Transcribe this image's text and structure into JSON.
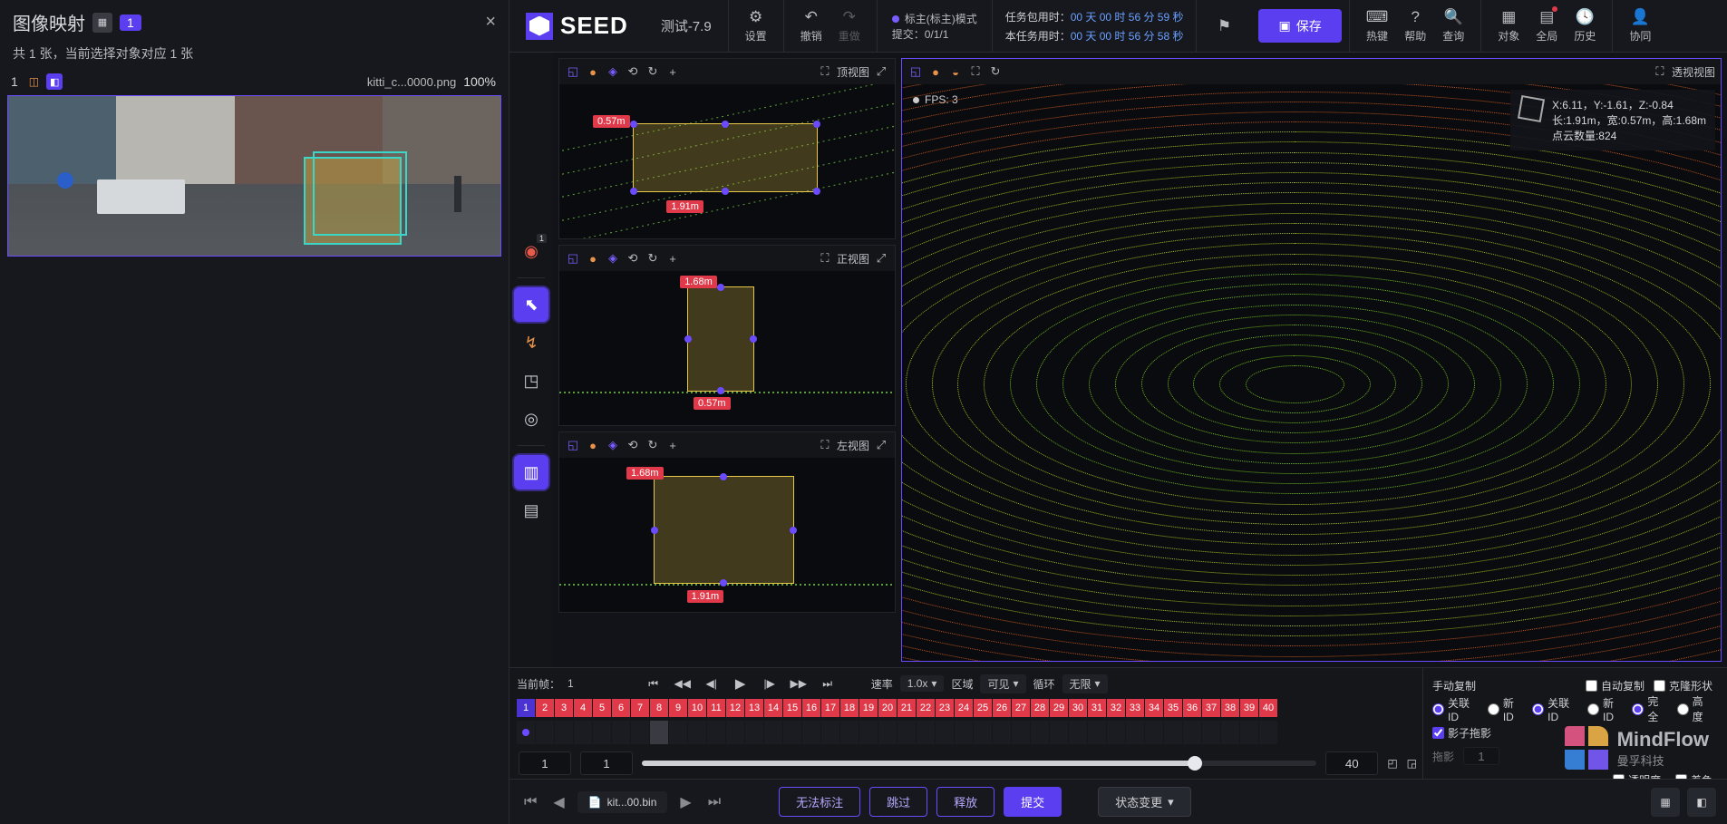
{
  "leftPanel": {
    "title": "图像映射",
    "badgeCount": "1",
    "subtitle": "共 1 张，当前选择对象对应 1 张",
    "thumb": {
      "index": "1",
      "file": "kitti_c...0000.png",
      "zoom": "100%"
    }
  },
  "header": {
    "logo": "SEED",
    "subtitle": "测试-7.9",
    "settings": "设置",
    "undo": "撤销",
    "redo": "重做",
    "mode": "标主(标主)模式",
    "submit": "提交：0/1/1",
    "time1Label": "任务包用时：",
    "time2Label": "本任务用时：",
    "time1": "00 天 00 时 56 分 59 秒",
    "time2": "00 天 00 时 56 分 58 秒",
    "save": "保存",
    "hotkey": "热键",
    "help": "帮助",
    "query": "查询",
    "object": "对象",
    "global": "全局",
    "history": "历史",
    "collab": "协同"
  },
  "views": {
    "top": "顶视图",
    "front": "正视图",
    "left": "左视图",
    "perspective": "透视视图",
    "fps": "FPS: 3",
    "info": {
      "coords": "X:6.11，Y:-1.61，Z:-0.84",
      "dims": "长:1.91m，宽:0.57m，高:1.68m",
      "points": "点云数量:824"
    },
    "dim": {
      "w": "0.57m",
      "l": "1.91m",
      "h": "1.68m"
    }
  },
  "timeline": {
    "curFrameLabel": "当前帧：",
    "curFrame": "1",
    "rateLabel": "速率",
    "rate": "1.0x",
    "regionLabel": "区域",
    "region": "可见",
    "loopLabel": "循环",
    "loop": "无限",
    "frameCount": 40,
    "numL": "1",
    "numR": "1",
    "numEnd": "40",
    "right": {
      "manualCopy": "手动复制",
      "autoCopy": "自动复制",
      "cloneShape": "克隆形状",
      "linkId": "关联ID",
      "newId": "新ID",
      "full": "完全",
      "height": "高度",
      "shadowDrag": "影子拖影",
      "drag": "拖影",
      "opacity": "透明度",
      "color": "着色"
    }
  },
  "bottom": {
    "file": "kit...00.bin",
    "cannot": "无法标注",
    "skip": "跳过",
    "release": "释放",
    "submit": "提交",
    "status": "状态变更"
  },
  "brand": {
    "en": "MindFlow",
    "cn": "曼孚科技"
  }
}
